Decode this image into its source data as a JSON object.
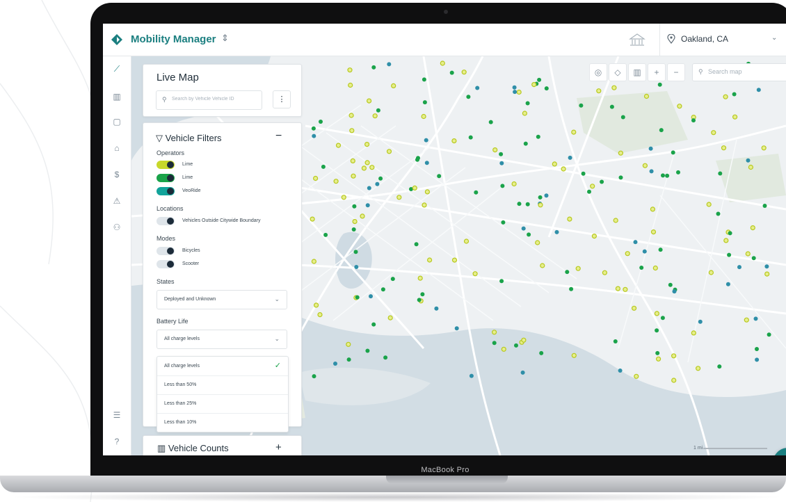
{
  "header": {
    "app_title": "Mobility Manager",
    "location": "Oakland, CA"
  },
  "rail": {
    "icons": [
      "chart-line-icon",
      "map-icon",
      "clipboard-icon",
      "bank-icon",
      "dollar-icon",
      "warning-icon",
      "badge-icon",
      "sliders-icon",
      "help-icon"
    ]
  },
  "live_map": {
    "title": "Live Map",
    "search_placeholder": "Search by Vehicle Vehicle ID"
  },
  "filters": {
    "title": "Vehicle Filters",
    "operators_label": "Operators",
    "operators": [
      {
        "label": "Lime",
        "color": "#c8d82a"
      },
      {
        "label": "Lime",
        "color": "#1aa34a"
      },
      {
        "label": "VeoRide",
        "color": "#12a39a"
      }
    ],
    "locations_label": "Locations",
    "locations": [
      {
        "label": "Vehicles Outside Citywide Boundary"
      }
    ],
    "modes_label": "Modes",
    "modes": [
      {
        "label": "Bicycles"
      },
      {
        "label": "Scooter"
      }
    ],
    "states_label": "States",
    "states_value": "Deployed and Unknown",
    "battery_label": "Battery Life",
    "battery_value": "All charge levels",
    "battery_options": [
      "All charge levels",
      "Less than 50%",
      "Less than 25%",
      "Less than 10%"
    ]
  },
  "counts": {
    "title": "Vehicle Counts"
  },
  "map": {
    "search_placeholder": "Search map",
    "scale_label": "1 mi",
    "dot_colors": {
      "lime": "#c8d82a",
      "green": "#1aa34a",
      "teal": "#2f8fa8"
    }
  },
  "device": {
    "label": "MacBook Pro"
  }
}
